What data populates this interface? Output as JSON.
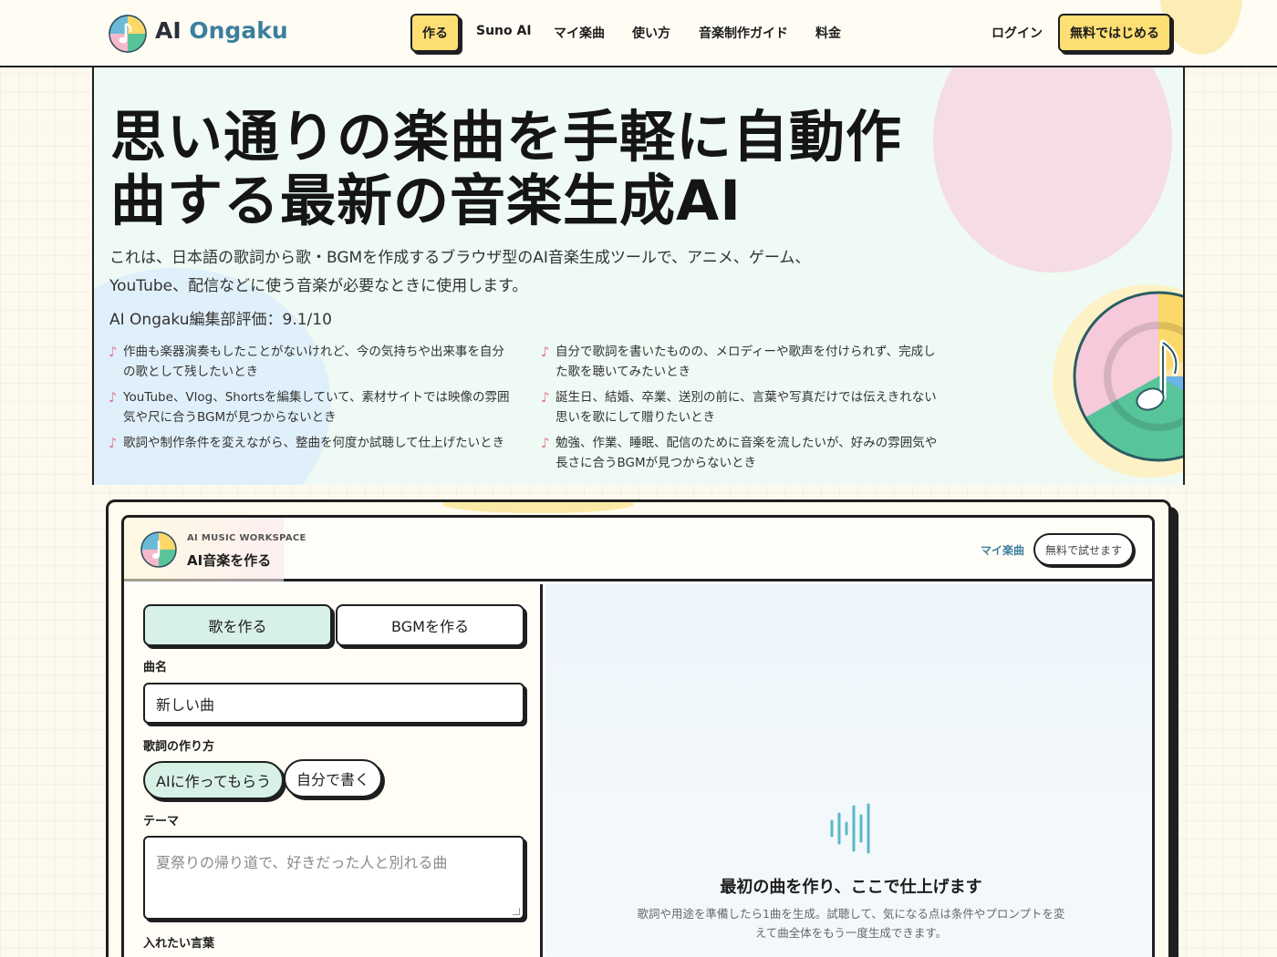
{
  "header": {
    "brand_prefix": "AI",
    "brand_accent": "Ongaku",
    "nav": [
      {
        "label": "作る",
        "active": true
      },
      {
        "label": "Suno AI"
      },
      {
        "label": "マイ楽曲"
      },
      {
        "label": "使い方"
      },
      {
        "label": "音楽制作ガイド"
      },
      {
        "label": "料金"
      }
    ],
    "login": "ログイン",
    "cta": "無料ではじめる"
  },
  "hero": {
    "title": "思い通りの楽曲を手軽に自動作曲する最新の音楽生成AI",
    "lead": "これは、日本語の歌詞から歌・BGMを作成するブラウザ型のAI音楽生成ツールで、アニメ、ゲーム、YouTube、配信などに使う音楽が必要なときに使用します。",
    "rating": "AI Ongaku編集部評価：9.1/10",
    "use_cases": [
      "作曲も楽器演奏もしたことがないけれど、今の気持ちや出来事を自分の歌として残したいとき",
      "自分で歌詞を書いたものの、メロディーや歌声を付けられず、完成した歌を聴いてみたいとき",
      "YouTube、Vlog、Shortsを編集していて、素材サイトでは映像の雰囲気や尺に合うBGMが見つからないとき",
      "誕生日、結婚、卒業、送別の前に、言葉や写真だけでは伝えきれない思いを歌にして贈りたいとき",
      "歌詞や制作条件を変えながら、整曲を何度か試聴して仕上げたいとき",
      "勉強、作業、睡眠、配信のために音楽を流したいが、好みの雰囲気や長さに合うBGMが見つからないとき"
    ],
    "bullet_glyph": "♪"
  },
  "workspace": {
    "eyebrow": "AI MUSIC WORKSPACE",
    "title": "AI音楽を作る",
    "my_songs": "マイ楽曲",
    "trial": "無料で試せます",
    "modes": {
      "song": "歌を作る",
      "bgm": "BGMを作る"
    },
    "song_name_label": "曲名",
    "song_name_value": "新しい曲",
    "lyrics_method_label": "歌詞の作り方",
    "lyrics_methods": {
      "ai": "AIに作ってもらう",
      "self": "自分で書く"
    },
    "theme_label": "テーマ",
    "theme_placeholder": "夏祭りの帰り道で、好きだった人と別れる曲",
    "words_label": "入れたい言葉",
    "empty_title": "最初の曲を作り、ここで仕上げます",
    "empty_desc": "歌詞や用途を準備したら1曲を生成。試聴して、気になる点は条件やプロンプトを変えて曲全体をもう一度生成できます。"
  },
  "colors": {
    "accent_yellow": "#fddf74",
    "accent_mint": "#d8f1e6",
    "brand_blue": "#3c7f9d",
    "ink": "#1f1f1f"
  },
  "icons": [
    "music-note-disc-icon",
    "waveform-icon"
  ]
}
